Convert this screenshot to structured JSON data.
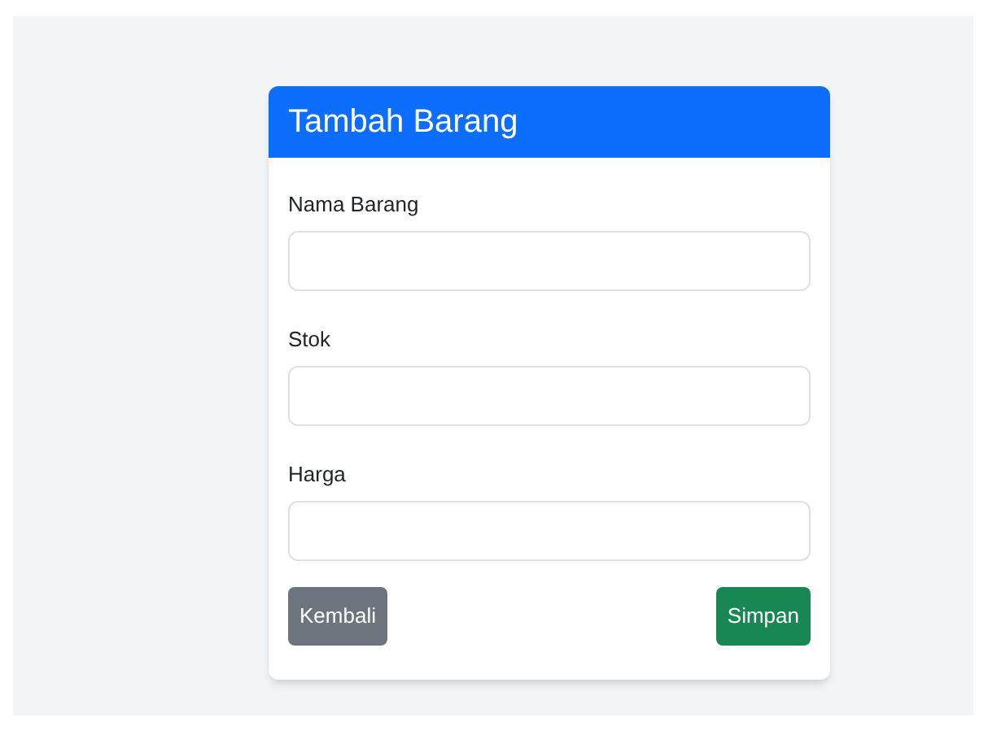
{
  "card": {
    "title": "Tambah Barang"
  },
  "fields": [
    {
      "label": "Nama Barang"
    },
    {
      "label": "Stok"
    },
    {
      "label": "Harga"
    }
  ],
  "buttons": [
    {
      "label": "Kembali",
      "kind": "secondary"
    },
    {
      "label": "Simpan",
      "kind": "primary"
    }
  ]
}
